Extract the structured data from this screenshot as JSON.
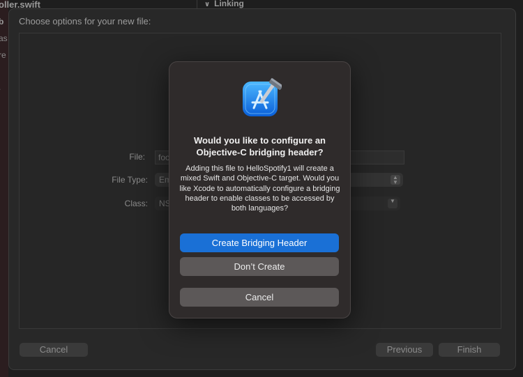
{
  "background": {
    "left_title_fragment": "oller.swift",
    "left_fragments": [
      "b",
      "as",
      "re",
      "."
    ],
    "section_header": "Linking"
  },
  "sheet": {
    "title": "Choose options for your new file:",
    "form": {
      "file_label": "File:",
      "file_value": "foo",
      "file_type_label": "File Type:",
      "file_type_value": "Em",
      "class_label": "Class:",
      "class_value": "NS"
    },
    "buttons": {
      "cancel": "Cancel",
      "previous": "Previous",
      "finish": "Finish"
    }
  },
  "dialog": {
    "icon": "xcode-app-icon",
    "title": "Would you like to configure an Objective-C bridging header?",
    "message": "Adding this file to HelloSpotify1 will create a mixed Swift and Objective-C target. Would you like Xcode to automatically configure a bridging header to enable classes to be accessed by both languages?",
    "buttons": {
      "create": "Create Bridging Header",
      "dont_create": "Don’t Create",
      "cancel": "Cancel"
    }
  },
  "colors": {
    "accent": "#1a70d6",
    "dialog_bg": "#2f2b2b",
    "secondary_button": "#5c5858"
  }
}
